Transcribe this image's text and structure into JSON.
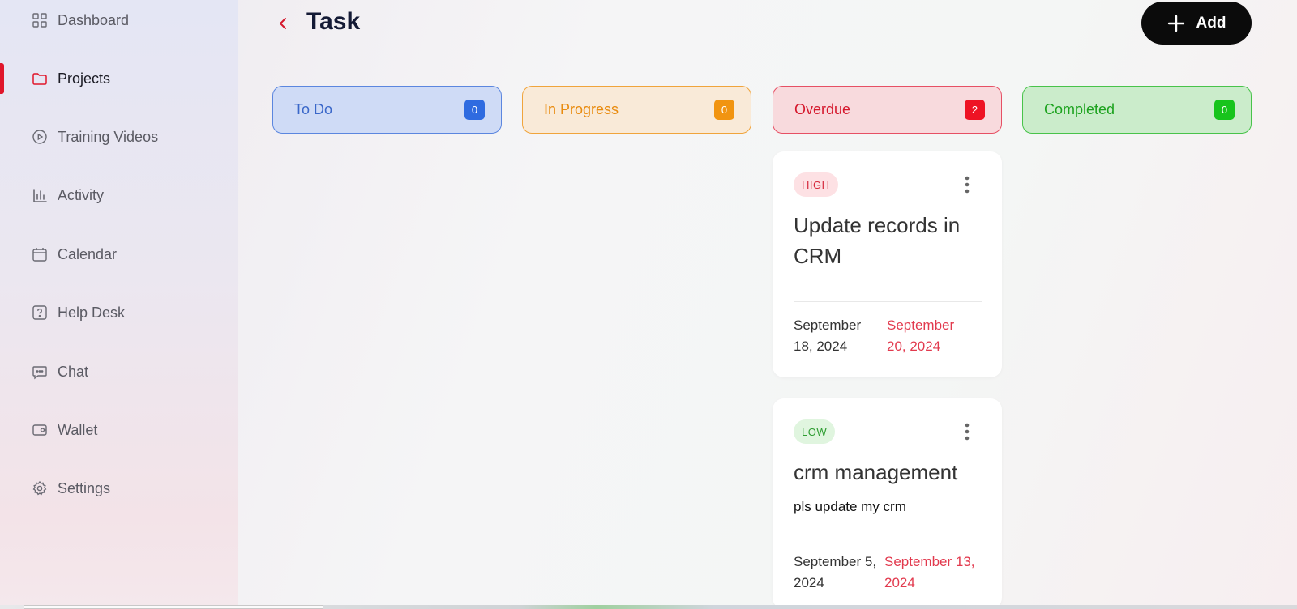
{
  "sidebar": {
    "items": [
      {
        "label": "Dashboard",
        "icon": "grid-icon"
      },
      {
        "label": "Projects",
        "icon": "folder-icon"
      },
      {
        "label": "Training Videos",
        "icon": "play-circle-icon"
      },
      {
        "label": "Activity",
        "icon": "bar-chart-icon"
      },
      {
        "label": "Calendar",
        "icon": "calendar-icon"
      },
      {
        "label": "Help Desk",
        "icon": "help-square-icon"
      },
      {
        "label": "Chat",
        "icon": "chat-bubble-icon"
      },
      {
        "label": "Wallet",
        "icon": "wallet-icon"
      },
      {
        "label": "Settings",
        "icon": "gear-icon"
      }
    ],
    "active": "Projects"
  },
  "header": {
    "title": "Task",
    "add_label": "Add"
  },
  "columns": [
    {
      "name": "To Do",
      "count": "0",
      "color": "#2f6be0"
    },
    {
      "name": "In Progress",
      "count": "0",
      "color": "#f19410"
    },
    {
      "name": "Overdue",
      "count": "2",
      "color": "#ee1324"
    },
    {
      "name": "Completed",
      "count": "0",
      "color": "#17c41c"
    }
  ],
  "cards": [
    {
      "priority": "HIGH",
      "title": "Update records in CRM",
      "description": "",
      "start_date": "September 18, 2024",
      "due_date": "September 20, 2024"
    },
    {
      "priority": "LOW",
      "title": "crm management",
      "description": "pls update my crm",
      "start_date": "September 5, 2024",
      "due_date": "September 13, 2024"
    }
  ],
  "colors": {
    "accent": "#e0162b",
    "title": "#141a35",
    "due_date": "#e23a4e"
  }
}
